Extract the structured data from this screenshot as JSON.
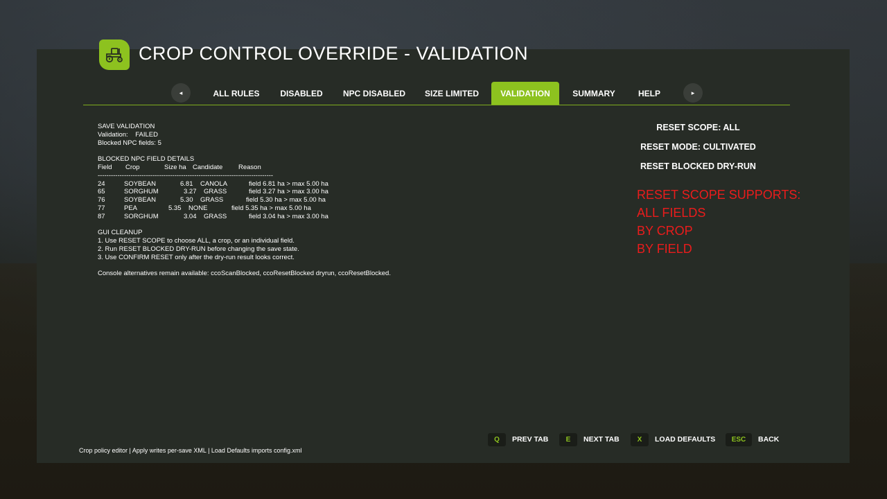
{
  "header": {
    "title": "CROP CONTROL OVERRIDE - VALIDATION",
    "icon": "tractor-icon",
    "accent": "#8dc21f"
  },
  "tabs": {
    "prev_arrow": "◂",
    "next_arrow": "▸",
    "items": [
      {
        "label": "ALL RULES",
        "active": false
      },
      {
        "label": "DISABLED",
        "active": false
      },
      {
        "label": "NPC DISABLED",
        "active": false
      },
      {
        "label": "SIZE LIMITED",
        "active": false
      },
      {
        "label": "VALIDATION",
        "active": true
      },
      {
        "label": "SUMMARY",
        "active": false
      },
      {
        "label": "HELP",
        "active": false
      }
    ]
  },
  "validation": {
    "heading": "SAVE VALIDATION",
    "validation_line": "Validation:    FAILED",
    "blocked_count_line": "Blocked NPC fields: 5",
    "details_heading": "BLOCKED NPC FIELD DETAILS",
    "columns": [
      "Field",
      "Crop",
      "Size ha",
      "Candidate",
      "Reason"
    ],
    "separator": "--------------------------------------------------------------------------------",
    "rows": [
      {
        "field": "24",
        "crop": "SOYBEAN",
        "size": "6.81",
        "candidate": "CANOLA",
        "reason": "field 6.81 ha > max 5.00 ha"
      },
      {
        "field": "65",
        "crop": "SORGHUM",
        "size": "3.27",
        "candidate": "GRASS",
        "reason": "field 3.27 ha > max 3.00 ha"
      },
      {
        "field": "76",
        "crop": "SOYBEAN",
        "size": "5.30",
        "candidate": "GRASS",
        "reason": "field 5.30 ha > max 5.00 ha"
      },
      {
        "field": "77",
        "crop": "PEA",
        "size": "5.35",
        "candidate": "NONE",
        "reason": "field 5.35 ha > max 5.00 ha"
      },
      {
        "field": "87",
        "crop": "SORGHUM",
        "size": "3.04",
        "candidate": "GRASS",
        "reason": "field 3.04 ha > max 3.00 ha"
      }
    ],
    "cleanup_heading": "GUI CLEANUP",
    "cleanup_steps": [
      "1. Use RESET SCOPE to choose ALL, a crop, or an individual field.",
      "2. Run RESET BLOCKED DRY-RUN before changing the save state.",
      "3. Use CONFIRM RESET only after the dry-run result looks correct."
    ],
    "console_note": "Console alternatives remain available: ccoScanBlocked, ccoResetBlocked dryrun, ccoResetBlocked."
  },
  "actions": {
    "reset_scope": "RESET SCOPE: ALL",
    "reset_mode": "RESET MODE: CULTIVATED",
    "reset_dry_run": "RESET BLOCKED DRY-RUN"
  },
  "notes": {
    "color": "#ea1c1c",
    "lines": [
      "RESET SCOPE SUPPORTS:",
      "ALL FIELDS",
      "BY CROP",
      "BY FIELD"
    ]
  },
  "footer": {
    "text": "Crop policy editor | Apply writes per-save XML | Load Defaults imports config.xml",
    "hints": [
      {
        "key": "Q",
        "label": "PREV TAB"
      },
      {
        "key": "E",
        "label": "NEXT TAB"
      },
      {
        "key": "X",
        "label": "LOAD DEFAULTS"
      },
      {
        "key": "ESC",
        "label": "BACK"
      }
    ]
  }
}
